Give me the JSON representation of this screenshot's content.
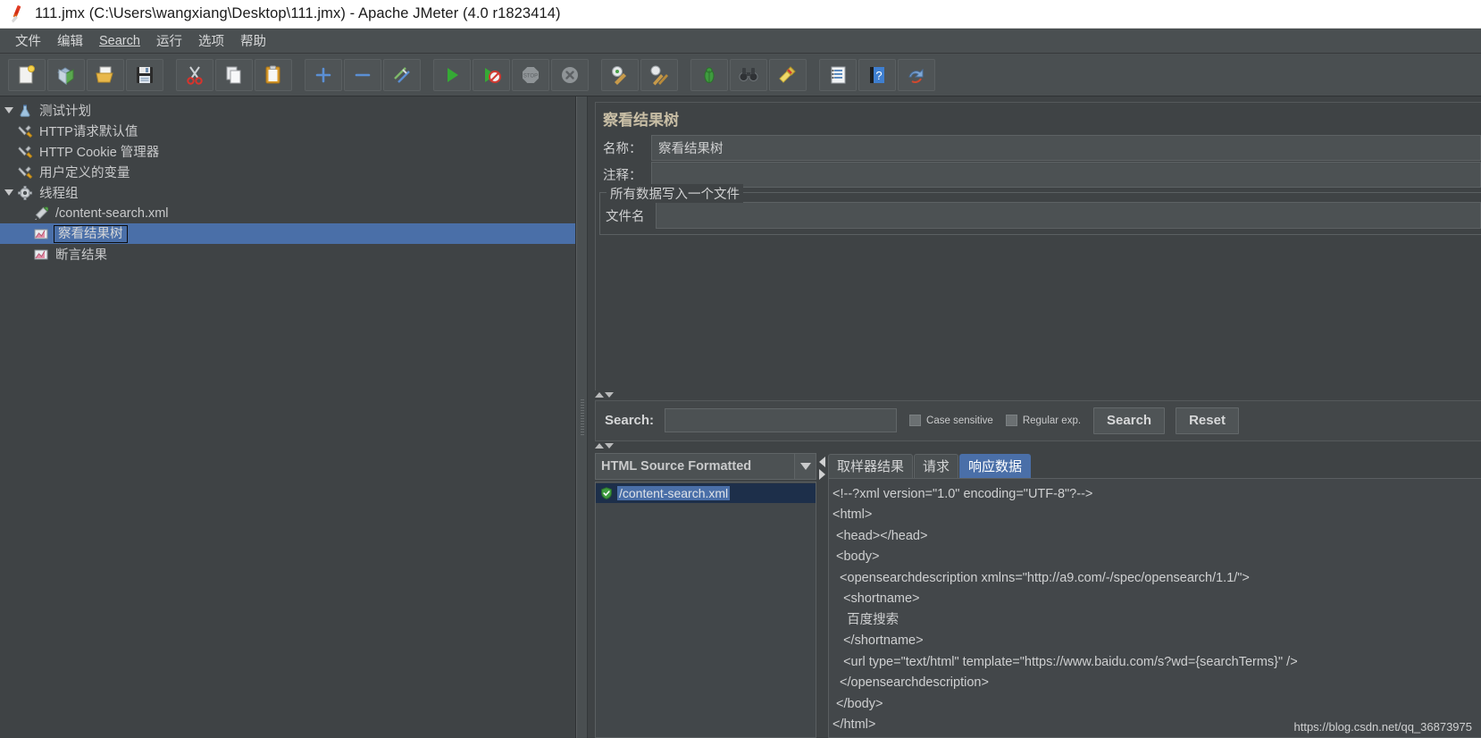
{
  "window": {
    "title": "111.jmx (C:\\Users\\wangxiang\\Desktop\\111.jmx) - Apache JMeter (4.0 r1823414)",
    "app_icon": "jmeter-feather-icon"
  },
  "menubar": {
    "items": [
      {
        "label": "文件",
        "underlined": false
      },
      {
        "label": "编辑",
        "underlined": false
      },
      {
        "label": "Search",
        "underlined": true
      },
      {
        "label": "运行",
        "underlined": false
      },
      {
        "label": "选项",
        "underlined": false
      },
      {
        "label": "帮助",
        "underlined": false
      }
    ]
  },
  "toolbar": {
    "buttons": [
      {
        "name": "new-test-plan-icon",
        "tooltip": "New"
      },
      {
        "name": "templates-icon",
        "tooltip": "Templates"
      },
      {
        "name": "open-folder-icon",
        "tooltip": "Open"
      },
      {
        "name": "save-floppy-icon",
        "tooltip": "Save"
      },
      {
        "name": "cut-scissors-icon",
        "tooltip": "Cut"
      },
      {
        "name": "copy-pages-icon",
        "tooltip": "Copy"
      },
      {
        "name": "paste-clipboard-icon",
        "tooltip": "Paste"
      },
      {
        "name": "expand-plus-icon",
        "tooltip": "Expand all"
      },
      {
        "name": "collapse-minus-icon",
        "tooltip": "Collapse all"
      },
      {
        "name": "toggle-enable-icon",
        "tooltip": "Toggle"
      },
      {
        "name": "start-play-icon",
        "tooltip": "Start"
      },
      {
        "name": "start-no-timers-icon",
        "tooltip": "Start no pauses"
      },
      {
        "name": "stop-icon",
        "tooltip": "Stop"
      },
      {
        "name": "shutdown-icon",
        "tooltip": "Shutdown"
      },
      {
        "name": "clear-broom-gear-icon",
        "tooltip": "Clear"
      },
      {
        "name": "clear-all-broom-icon",
        "tooltip": "Clear all"
      },
      {
        "name": "function-helper-bug-icon",
        "tooltip": "Function Helper"
      },
      {
        "name": "search-binoculars-icon",
        "tooltip": "Search"
      },
      {
        "name": "reset-search-broom-icon",
        "tooltip": "Reset Search"
      },
      {
        "name": "log-viewer-icon",
        "tooltip": "Log viewer"
      },
      {
        "name": "help-book-icon",
        "tooltip": "Help"
      },
      {
        "name": "undo-redo-icon",
        "tooltip": "Undo"
      }
    ]
  },
  "tree": {
    "nodes": [
      {
        "label": "测试计划",
        "icon": "test-plan-icon",
        "indent": 0,
        "expandable": true,
        "selected": false
      },
      {
        "label": "HTTP请求默认值",
        "icon": "config-wrench-icon",
        "indent": 1,
        "expandable": false,
        "selected": false
      },
      {
        "label": "HTTP Cookie 管理器",
        "icon": "config-wrench-icon",
        "indent": 1,
        "expandable": false,
        "selected": false
      },
      {
        "label": "用户定义的变量",
        "icon": "config-wrench-icon",
        "indent": 1,
        "expandable": false,
        "selected": false
      },
      {
        "label": "线程组",
        "icon": "thread-group-gear-icon",
        "indent": 0,
        "expandable": true,
        "selected": false
      },
      {
        "label": "/content-search.xml",
        "icon": "http-sampler-pen-icon",
        "indent": 2,
        "expandable": false,
        "selected": false
      },
      {
        "label": "察看结果树",
        "icon": "listener-chart-icon",
        "indent": 2,
        "expandable": false,
        "selected": true
      },
      {
        "label": "断言结果",
        "icon": "listener-chart-icon",
        "indent": 2,
        "expandable": false,
        "selected": false
      }
    ]
  },
  "editor": {
    "panel_title": "察看结果树",
    "name_label": "名称：",
    "name_value": "察看结果树",
    "comment_label": "注释：",
    "comment_value": "",
    "filegroup_title": "所有数据写入一个文件",
    "filename_label": "文件名",
    "filename_value": ""
  },
  "search_bar": {
    "label": "Search:",
    "input_value": "",
    "case_sensitive_label": "Case sensitive",
    "case_sensitive_checked": false,
    "regular_exp_label": "Regular exp.",
    "regular_exp_checked": false,
    "search_button": "Search",
    "reset_button": "Reset"
  },
  "results": {
    "renderer_selected": "HTML Source Formatted",
    "items": [
      {
        "label": "/content-search.xml",
        "status_icon": "success-shield-icon",
        "selected": true
      }
    ]
  },
  "tabs": [
    {
      "label": "取样器结果",
      "active": false
    },
    {
      "label": "请求",
      "active": false
    },
    {
      "label": "响应数据",
      "active": true
    }
  ],
  "response_data": {
    "lines": [
      "<!--?xml version=\"1.0\" encoding=\"UTF-8\"?-->",
      "<html>",
      " <head></head>",
      " <body>",
      "  <opensearchdescription xmlns=\"http://a9.com/-/spec/opensearch/1.1/\">",
      "   <shortname>",
      "    百度搜索",
      "   </shortname>",
      "   <url type=\"text/html\" template=\"https://www.baidu.com/s?wd={searchTerms}\" />",
      "  </opensearchdescription>",
      " </body>",
      "</html>"
    ]
  },
  "watermark": "https://blog.csdn.net/qq_36873975",
  "colors": {
    "selection_blue": "#4a6fa8",
    "panel_bg": "#3f4345",
    "toolbar_bg": "#4a4f51",
    "title_gold": "#c9bfa6"
  }
}
